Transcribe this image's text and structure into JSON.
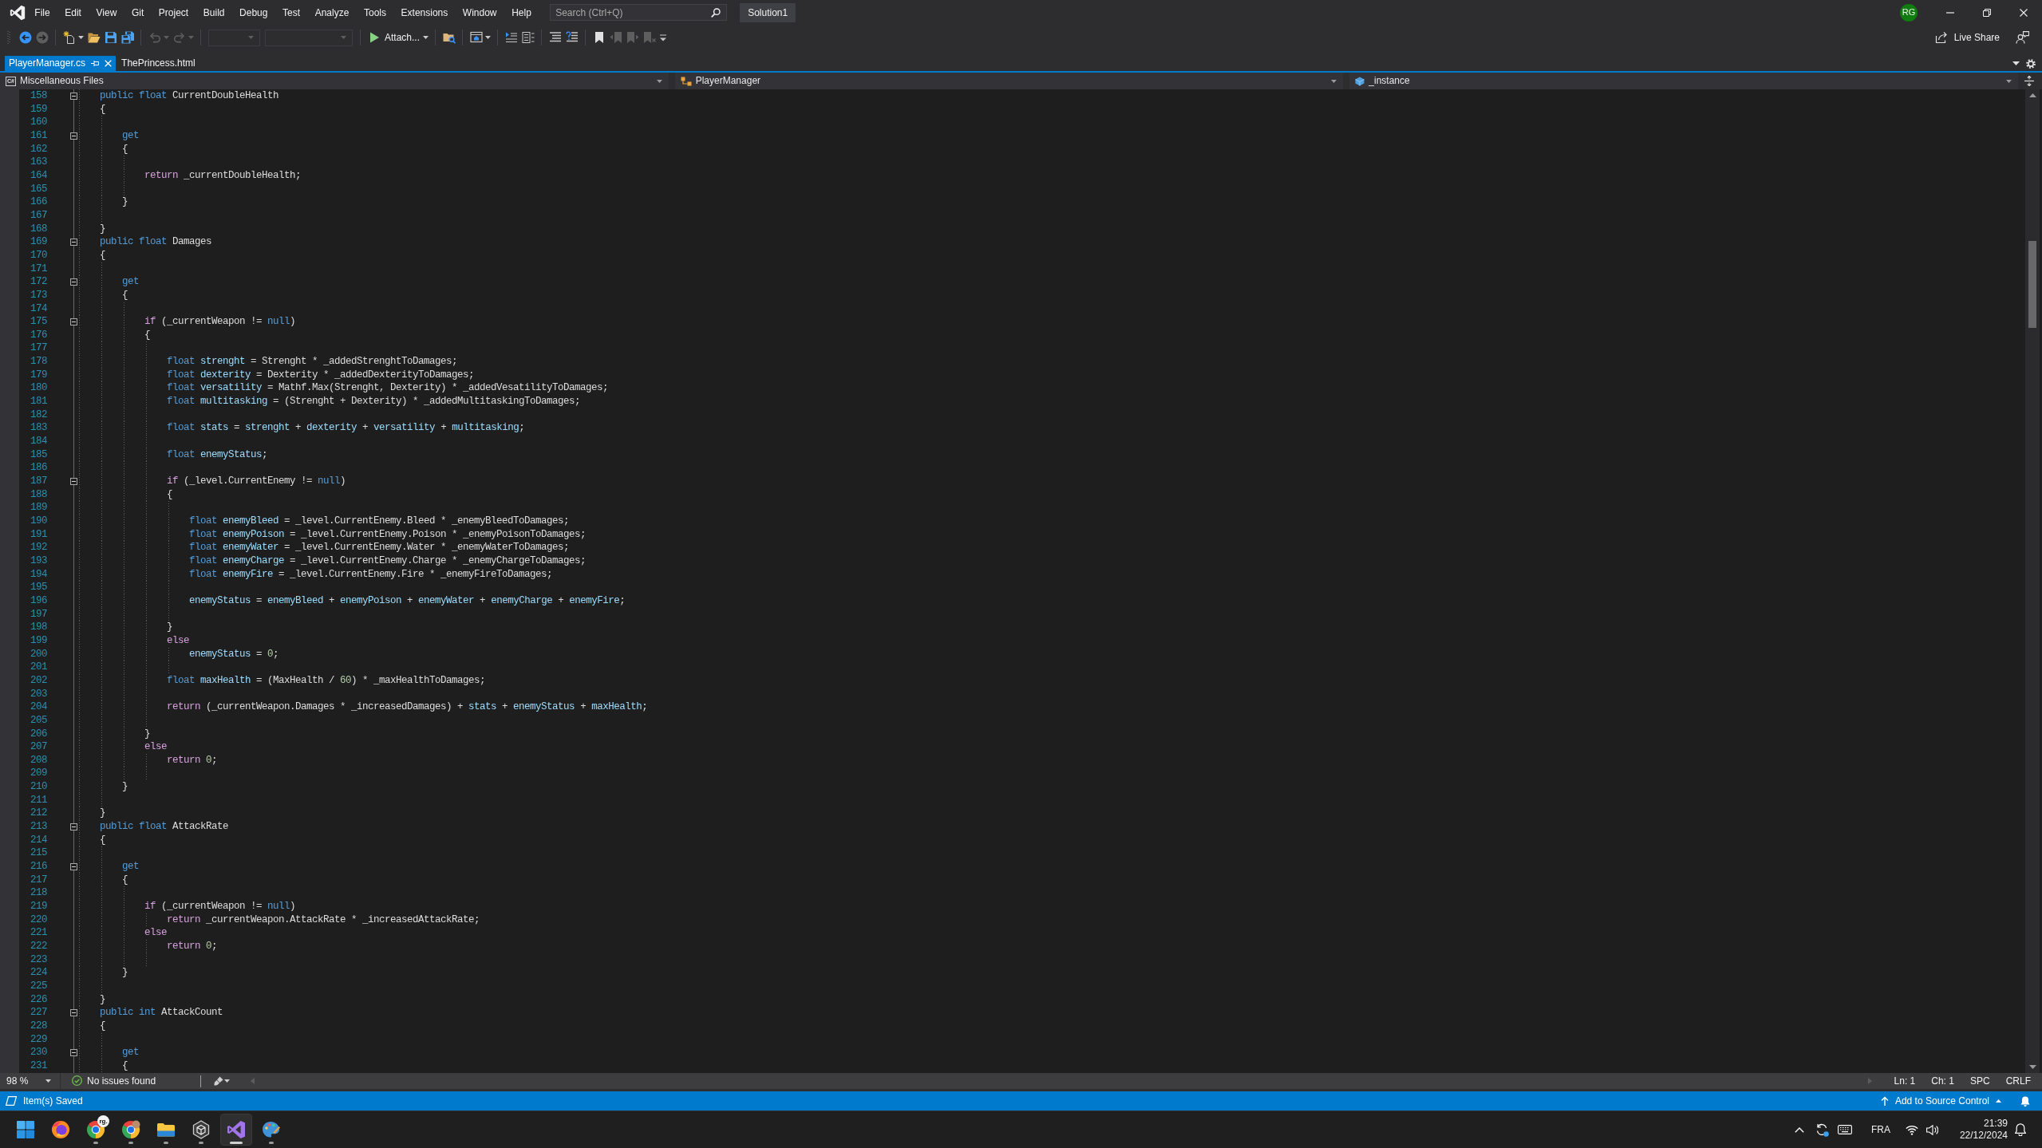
{
  "title_bar": {
    "menu": [
      "File",
      "Edit",
      "View",
      "Git",
      "Project",
      "Build",
      "Debug",
      "Test",
      "Analyze",
      "Tools",
      "Extensions",
      "Window",
      "Help"
    ],
    "search": {
      "placeholder": "Search (Ctrl+Q)"
    },
    "solution": "Solution1",
    "account_initials": "RG"
  },
  "toolbar": {
    "groups": [
      {
        "buttons": [
          {
            "kind": "back",
            "disabled": false,
            "dropdown": false
          },
          {
            "kind": "forward",
            "disabled": true,
            "dropdown": false
          }
        ]
      },
      {
        "buttons": [
          {
            "kind": "new",
            "disabled": false,
            "dropdown": true
          },
          {
            "kind": "open",
            "disabled": false,
            "dropdown": false
          },
          {
            "kind": "save",
            "disabled": false,
            "dropdown": false
          },
          {
            "kind": "saveall",
            "disabled": false,
            "dropdown": false
          }
        ]
      },
      {
        "buttons": [
          {
            "kind": "undo",
            "disabled": true,
            "dropdown": true
          },
          {
            "kind": "redo",
            "disabled": true,
            "dropdown": true
          }
        ]
      },
      {
        "buttons": [
          {
            "kind": "shortcombo",
            "disabled": true,
            "dropdown": false
          },
          {
            "kind": "longcombo",
            "disabled": true,
            "dropdown": false
          }
        ]
      },
      {
        "buttons": [
          {
            "kind": "run",
            "label": "Attach...",
            "disabled": false,
            "dropdown": true
          }
        ]
      },
      {
        "buttons": [
          {
            "kind": "findfiles",
            "disabled": false,
            "dropdown": false
          }
        ]
      },
      {
        "buttons": [
          {
            "kind": "window",
            "disabled": false,
            "dropdown": true
          }
        ]
      },
      {
        "buttons": [
          {
            "kind": "indent",
            "disabled": false,
            "dropdown": false
          },
          {
            "kind": "outline",
            "disabled": false,
            "dropdown": false
          }
        ]
      },
      {
        "buttons": [
          {
            "kind": "comment",
            "disabled": false,
            "dropdown": false
          },
          {
            "kind": "uncomment",
            "disabled": false,
            "dropdown": false
          }
        ]
      },
      {
        "buttons": [
          {
            "kind": "bookmark",
            "disabled": false,
            "dropdown": false
          },
          {
            "kind": "prevbookmark",
            "disabled": true,
            "dropdown": false
          },
          {
            "kind": "nextbookmark",
            "disabled": true,
            "dropdown": false
          },
          {
            "kind": "clearbookmark",
            "disabled": true,
            "dropdown": false
          },
          {
            "kind": "overflow",
            "disabled": false,
            "dropdown": false
          }
        ]
      }
    ],
    "live_share": "Live Share"
  },
  "tabs": [
    {
      "label": "PlayerManager.cs",
      "selected": true
    },
    {
      "label": "ThePrincess.html",
      "selected": false
    }
  ],
  "navigation_bar": {
    "project": {
      "icon_text": "C#",
      "label": "Miscellaneous Files"
    },
    "type": "PlayerManager",
    "member": "_instance"
  },
  "editor": {
    "lines": [
      {
        "number": "158",
        "collapsible": true,
        "tokens": [
          {
            "kind": "keyword",
            "text": "    public float "
          },
          {
            "kind": "plain",
            "text": "CurrentDoubleHealth"
          }
        ]
      },
      {
        "number": "159",
        "collapsible": false,
        "tokens": [
          {
            "kind": "plain",
            "text": "    {"
          }
        ]
      },
      {
        "number": "160",
        "collapsible": false
      },
      {
        "number": "161",
        "collapsible": true,
        "tokens": [
          {
            "kind": "keyword",
            "text": "        get"
          }
        ]
      },
      {
        "number": "162",
        "collapsible": false,
        "tokens": [
          {
            "kind": "plain",
            "text": "        {"
          }
        ]
      },
      {
        "number": "163",
        "collapsible": false
      },
      {
        "number": "164",
        "collapsible": false,
        "tokens": [
          {
            "kind": "control",
            "text": "            return"
          },
          {
            "kind": "plain",
            "text": " _currentDoubleHealth;"
          }
        ]
      },
      {
        "number": "165",
        "collapsible": false
      },
      {
        "number": "166",
        "collapsible": false,
        "tokens": [
          {
            "kind": "plain",
            "text": "        }"
          }
        ]
      },
      {
        "number": "167",
        "collapsible": false
      },
      {
        "number": "168",
        "collapsible": false,
        "tokens": [
          {
            "kind": "plain",
            "text": "    }"
          }
        ]
      },
      {
        "number": "169",
        "collapsible": true,
        "tokens": [
          {
            "kind": "keyword",
            "text": "    public float "
          },
          {
            "kind": "plain",
            "text": "Damages"
          }
        ]
      },
      {
        "number": "170",
        "collapsible": false,
        "tokens": [
          {
            "kind": "plain",
            "text": "    {"
          }
        ]
      },
      {
        "number": "171",
        "collapsible": false
      },
      {
        "number": "172",
        "collapsible": true,
        "tokens": [
          {
            "kind": "keyword",
            "text": "        get"
          }
        ]
      },
      {
        "number": "173",
        "collapsible": false,
        "tokens": [
          {
            "kind": "plain",
            "text": "        {"
          }
        ]
      },
      {
        "number": "174",
        "collapsible": false
      },
      {
        "number": "175",
        "collapsible": true,
        "tokens": [
          {
            "kind": "control",
            "text": "            if"
          },
          {
            "kind": "plain",
            "text": " (_currentWeapon != "
          },
          {
            "kind": "keyword",
            "text": "null"
          },
          {
            "kind": "plain",
            "text": ")"
          }
        ]
      },
      {
        "number": "176",
        "collapsible": false,
        "tokens": [
          {
            "kind": "plain",
            "text": "            {"
          }
        ]
      },
      {
        "number": "177",
        "collapsible": false
      },
      {
        "number": "178",
        "collapsible": false,
        "tokens": [
          {
            "kind": "keyword",
            "text": "                float "
          },
          {
            "kind": "local",
            "text": "strenght"
          },
          {
            "kind": "plain",
            "text": " = Strenght * _addedStrenghtToDamages;"
          }
        ]
      },
      {
        "number": "179",
        "collapsible": false,
        "tokens": [
          {
            "kind": "keyword",
            "text": "                float "
          },
          {
            "kind": "local",
            "text": "dexterity"
          },
          {
            "kind": "plain",
            "text": " = Dexterity * _addedDexterityToDamages;"
          }
        ]
      },
      {
        "number": "180",
        "collapsible": false,
        "tokens": [
          {
            "kind": "keyword",
            "text": "                float "
          },
          {
            "kind": "local",
            "text": "versatility"
          },
          {
            "kind": "plain",
            "text": " = Mathf.Max(Strenght, Dexterity) * _addedVesatilityToDamages;"
          }
        ]
      },
      {
        "number": "181",
        "collapsible": false,
        "tokens": [
          {
            "kind": "keyword",
            "text": "                float "
          },
          {
            "kind": "local",
            "text": "multitasking"
          },
          {
            "kind": "plain",
            "text": " = (Strenght + Dexterity) * _addedMultitaskingToDamages;"
          }
        ]
      },
      {
        "number": "182",
        "collapsible": false
      },
      {
        "number": "183",
        "collapsible": false,
        "tokens": [
          {
            "kind": "keyword",
            "text": "                float "
          },
          {
            "kind": "local",
            "text": "stats"
          },
          {
            "kind": "plain",
            "text": " = "
          },
          {
            "kind": "local",
            "text": "strenght"
          },
          {
            "kind": "plain",
            "text": " + "
          },
          {
            "kind": "local",
            "text": "dexterity"
          },
          {
            "kind": "plain",
            "text": " + "
          },
          {
            "kind": "local",
            "text": "versatility"
          },
          {
            "kind": "plain",
            "text": " + "
          },
          {
            "kind": "local",
            "text": "multitasking"
          },
          {
            "kind": "plain",
            "text": ";"
          }
        ]
      },
      {
        "number": "184",
        "collapsible": false
      },
      {
        "number": "185",
        "collapsible": false,
        "tokens": [
          {
            "kind": "keyword",
            "text": "                float "
          },
          {
            "kind": "local",
            "text": "enemyStatus"
          },
          {
            "kind": "plain",
            "text": ";"
          }
        ]
      },
      {
        "number": "186",
        "collapsible": false
      },
      {
        "number": "187",
        "collapsible": true,
        "tokens": [
          {
            "kind": "control",
            "text": "                if"
          },
          {
            "kind": "plain",
            "text": " (_level.CurrentEnemy != "
          },
          {
            "kind": "keyword",
            "text": "null"
          },
          {
            "kind": "plain",
            "text": ")"
          }
        ]
      },
      {
        "number": "188",
        "collapsible": false,
        "tokens": [
          {
            "kind": "plain",
            "text": "                {"
          }
        ]
      },
      {
        "number": "189",
        "collapsible": false
      },
      {
        "number": "190",
        "collapsible": false,
        "tokens": [
          {
            "kind": "keyword",
            "text": "                    float "
          },
          {
            "kind": "local",
            "text": "enemyBleed"
          },
          {
            "kind": "plain",
            "text": " = _level.CurrentEnemy.Bleed * _enemyBleedToDamages;"
          }
        ]
      },
      {
        "number": "191",
        "collapsible": false,
        "tokens": [
          {
            "kind": "keyword",
            "text": "                    float "
          },
          {
            "kind": "local",
            "text": "enemyPoison"
          },
          {
            "kind": "plain",
            "text": " = _level.CurrentEnemy.Poison * _enemyPoisonToDamages;"
          }
        ]
      },
      {
        "number": "192",
        "collapsible": false,
        "tokens": [
          {
            "kind": "keyword",
            "text": "                    float "
          },
          {
            "kind": "local",
            "text": "enemyWater"
          },
          {
            "kind": "plain",
            "text": " = _level.CurrentEnemy.Water * _enemyWaterToDamages;"
          }
        ]
      },
      {
        "number": "193",
        "collapsible": false,
        "tokens": [
          {
            "kind": "keyword",
            "text": "                    float "
          },
          {
            "kind": "local",
            "text": "enemyCharge"
          },
          {
            "kind": "plain",
            "text": " = _level.CurrentEnemy.Charge * _enemyChargeToDamages;"
          }
        ]
      },
      {
        "number": "194",
        "collapsible": false,
        "tokens": [
          {
            "kind": "keyword",
            "text": "                    float "
          },
          {
            "kind": "local",
            "text": "enemyFire"
          },
          {
            "kind": "plain",
            "text": " = _level.CurrentEnemy.Fire * _enemyFireToDamages;"
          }
        ]
      },
      {
        "number": "195",
        "collapsible": false
      },
      {
        "number": "196",
        "collapsible": false,
        "tokens": [
          {
            "kind": "local",
            "text": "                    enemyStatus"
          },
          {
            "kind": "plain",
            "text": " = "
          },
          {
            "kind": "local",
            "text": "enemyBleed"
          },
          {
            "kind": "plain",
            "text": " + "
          },
          {
            "kind": "local",
            "text": "enemyPoison"
          },
          {
            "kind": "plain",
            "text": " + "
          },
          {
            "kind": "local",
            "text": "enemyWater"
          },
          {
            "kind": "plain",
            "text": " + "
          },
          {
            "kind": "local",
            "text": "enemyCharge"
          },
          {
            "kind": "plain",
            "text": " + "
          },
          {
            "kind": "local",
            "text": "enemyFire"
          },
          {
            "kind": "plain",
            "text": ";"
          }
        ]
      },
      {
        "number": "197",
        "collapsible": false
      },
      {
        "number": "198",
        "collapsible": false,
        "tokens": [
          {
            "kind": "plain",
            "text": "                }"
          }
        ]
      },
      {
        "number": "199",
        "collapsible": false,
        "tokens": [
          {
            "kind": "control",
            "text": "                else"
          }
        ]
      },
      {
        "number": "200",
        "collapsible": false,
        "tokens": [
          {
            "kind": "local",
            "text": "                    enemyStatus"
          },
          {
            "kind": "plain",
            "text": " = "
          },
          {
            "kind": "number",
            "text": "0"
          },
          {
            "kind": "plain",
            "text": ";"
          }
        ]
      },
      {
        "number": "201",
        "collapsible": false
      },
      {
        "number": "202",
        "collapsible": false,
        "tokens": [
          {
            "kind": "keyword",
            "text": "                float "
          },
          {
            "kind": "local",
            "text": "maxHealth"
          },
          {
            "kind": "plain",
            "text": " = (MaxHealth / "
          },
          {
            "kind": "number",
            "text": "60"
          },
          {
            "kind": "plain",
            "text": ") * _maxHealthToDamages;"
          }
        ]
      },
      {
        "number": "203",
        "collapsible": false
      },
      {
        "number": "204",
        "collapsible": false,
        "tokens": [
          {
            "kind": "control",
            "text": "                return"
          },
          {
            "kind": "plain",
            "text": " (_currentWeapon.Damages * _increasedDamages) + "
          },
          {
            "kind": "local",
            "text": "stats"
          },
          {
            "kind": "plain",
            "text": " + "
          },
          {
            "kind": "local",
            "text": "enemyStatus"
          },
          {
            "kind": "plain",
            "text": " + "
          },
          {
            "kind": "local",
            "text": "maxHealth"
          },
          {
            "kind": "plain",
            "text": ";"
          }
        ]
      },
      {
        "number": "205",
        "collapsible": false
      },
      {
        "number": "206",
        "collapsible": false,
        "tokens": [
          {
            "kind": "plain",
            "text": "            }"
          }
        ]
      },
      {
        "number": "207",
        "collapsible": false,
        "tokens": [
          {
            "kind": "control",
            "text": "            else"
          }
        ]
      },
      {
        "number": "208",
        "collapsible": false,
        "tokens": [
          {
            "kind": "control",
            "text": "                return "
          },
          {
            "kind": "number",
            "text": "0"
          },
          {
            "kind": "plain",
            "text": ";"
          }
        ]
      },
      {
        "number": "209",
        "collapsible": false
      },
      {
        "number": "210",
        "collapsible": false,
        "tokens": [
          {
            "kind": "plain",
            "text": "        }"
          }
        ]
      },
      {
        "number": "211",
        "collapsible": false
      },
      {
        "number": "212",
        "collapsible": false,
        "tokens": [
          {
            "kind": "plain",
            "text": "    }"
          }
        ]
      },
      {
        "number": "213",
        "collapsible": true,
        "tokens": [
          {
            "kind": "keyword",
            "text": "    public float "
          },
          {
            "kind": "plain",
            "text": "AttackRate"
          }
        ]
      },
      {
        "number": "214",
        "collapsible": false,
        "tokens": [
          {
            "kind": "plain",
            "text": "    {"
          }
        ]
      },
      {
        "number": "215",
        "collapsible": false
      },
      {
        "number": "216",
        "collapsible": true,
        "tokens": [
          {
            "kind": "keyword",
            "text": "        get"
          }
        ]
      },
      {
        "number": "217",
        "collapsible": false,
        "tokens": [
          {
            "kind": "plain",
            "text": "        {"
          }
        ]
      },
      {
        "number": "218",
        "collapsible": false
      },
      {
        "number": "219",
        "collapsible": false,
        "tokens": [
          {
            "kind": "control",
            "text": "            if"
          },
          {
            "kind": "plain",
            "text": " (_currentWeapon != "
          },
          {
            "kind": "keyword",
            "text": "null"
          },
          {
            "kind": "plain",
            "text": ")"
          }
        ]
      },
      {
        "number": "220",
        "collapsible": false,
        "tokens": [
          {
            "kind": "control",
            "text": "                return"
          },
          {
            "kind": "plain",
            "text": " _currentWeapon.AttackRate * _increasedAttackRate;"
          }
        ]
      },
      {
        "number": "221",
        "collapsible": false,
        "tokens": [
          {
            "kind": "control",
            "text": "            else"
          }
        ]
      },
      {
        "number": "222",
        "collapsible": false,
        "tokens": [
          {
            "kind": "control",
            "text": "                return "
          },
          {
            "kind": "number",
            "text": "0"
          },
          {
            "kind": "plain",
            "text": ";"
          }
        ]
      },
      {
        "number": "223",
        "collapsible": false
      },
      {
        "number": "224",
        "collapsible": false,
        "tokens": [
          {
            "kind": "plain",
            "text": "        }"
          }
        ]
      },
      {
        "number": "225",
        "collapsible": false
      },
      {
        "number": "226",
        "collapsible": false,
        "tokens": [
          {
            "kind": "plain",
            "text": "    }"
          }
        ]
      },
      {
        "number": "227",
        "collapsible": true,
        "tokens": [
          {
            "kind": "keyword",
            "text": "    public int "
          },
          {
            "kind": "plain",
            "text": "AttackCount"
          }
        ]
      },
      {
        "number": "228",
        "collapsible": false,
        "tokens": [
          {
            "kind": "plain",
            "text": "    {"
          }
        ]
      },
      {
        "number": "229",
        "collapsible": false
      },
      {
        "number": "230",
        "collapsible": true,
        "tokens": [
          {
            "kind": "keyword",
            "text": "        get"
          }
        ]
      },
      {
        "number": "231",
        "collapsible": false,
        "tokens": [
          {
            "kind": "plain",
            "text": "        {"
          }
        ]
      }
    ]
  },
  "editor_status": {
    "zoom": "98 %",
    "issues": "No issues found",
    "line": "Ln: 1",
    "column": "Ch: 1",
    "whitespace": "SPC",
    "line_endings": "CRLF"
  },
  "status_bar": {
    "message": "Item(s) Saved",
    "source_control": "Add to Source Control"
  },
  "taskbar": {
    "apps": [
      {
        "kind": "start",
        "running": false,
        "selected": false
      },
      {
        "kind": "fox",
        "running": false,
        "selected": false
      },
      {
        "kind": "ring",
        "running": true,
        "selected": false,
        "badge": "rg."
      },
      {
        "kind": "ringphoto",
        "running": true,
        "selected": false
      },
      {
        "kind": "folder",
        "running": true,
        "selected": false
      },
      {
        "kind": "cube",
        "running": true,
        "selected": false
      },
      {
        "kind": "ribbon",
        "running": true,
        "selected": true
      },
      {
        "kind": "palette",
        "running": true,
        "selected": false
      }
    ],
    "language": "FRA",
    "time": "21:39",
    "date": "22/12/2024"
  }
}
